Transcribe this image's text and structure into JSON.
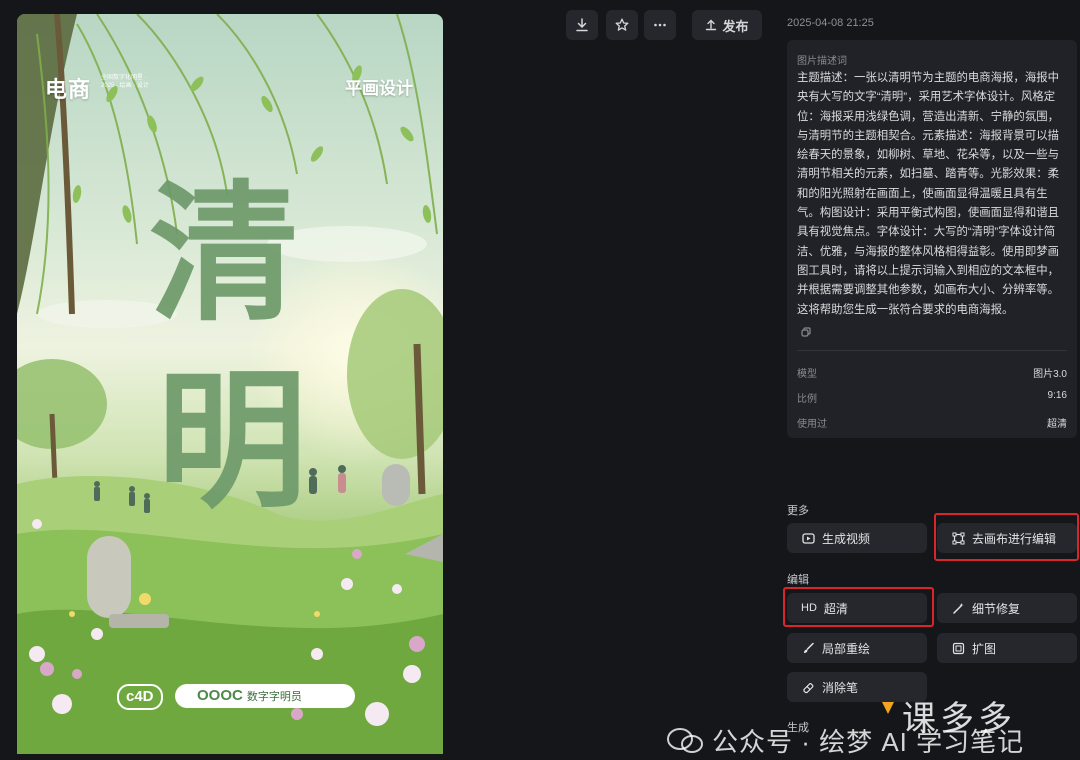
{
  "poster": {
    "brand": "电商",
    "brand_sub": "全国数字化明星 · 2025 · 绘画 · 设计",
    "tag": "平画设计",
    "title_char_1": "清",
    "title_char_2": "明",
    "badge_left": "c4D",
    "badge_right_main": "OOOC",
    "badge_right_sub": "数字字明员"
  },
  "toolbar": {
    "download_icon": "download-icon",
    "favorite_icon": "star-icon",
    "more_icon": "more-icon",
    "publish_label": "发布"
  },
  "detail": {
    "timestamp": "2025-04-08 21:25",
    "description_label": "图片描述词",
    "description": "主题描述：一张以清明节为主题的电商海报，海报中央有大写的文字“清明”，采用艺术字体设计。风格定位：海报采用浅绿色调，营造出清新、宁静的氛围，与清明节的主题相契合。元素描述：海报背景可以描绘春天的景象，如柳树、草地、花朵等，以及一些与清明节相关的元素，如扫墓、踏青等。光影效果：柔和的阳光照射在画面上，使画面显得温暖且具有生气。构图设计：采用平衡式构图，使画面显得和谐且具有视觉焦点。字体设计：大写的“清明”字体设计简洁、优雅，与海报的整体风格相得益彰。使用即梦画图工具时，请将以上提示词输入到相应的文本框中，并根据需要调整其他参数，如画布大小、分辨率等。这将帮助您生成一张符合要求的电商海报。",
    "meta": [
      {
        "label": "模型",
        "value": "图片3.0"
      },
      {
        "label": "比例",
        "value": "9:16"
      },
      {
        "label": "使用过",
        "value": "超清"
      }
    ]
  },
  "sections": {
    "more": "更多",
    "edit": "编辑",
    "generate": "生成"
  },
  "actions": {
    "generate_video": "生成视频",
    "canvas_edit": "去画布进行编辑",
    "hd_prefix": "HD",
    "hd": "超清",
    "detail_fix": "细节修复",
    "inpaint": "局部重绘",
    "expand": "扩图",
    "eraser": "消除笔"
  },
  "watermark": {
    "text": "公众号 · 绘梦 AI 学习笔记"
  },
  "colors": {
    "background": "#15161a",
    "card": "#212227",
    "button": "#26272c",
    "highlight": "#d9262b"
  }
}
